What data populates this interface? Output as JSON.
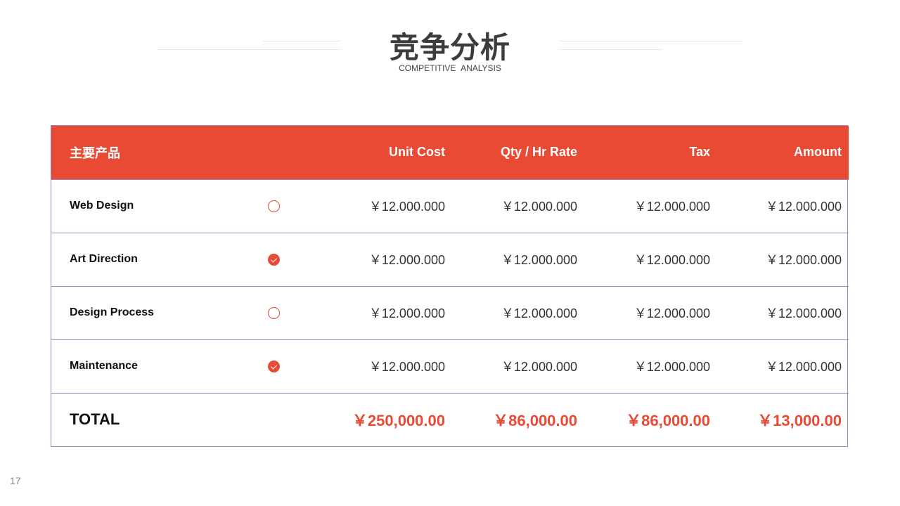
{
  "header": {
    "title": "竞争分析",
    "subtitle": "COMPETITIVE  ANALYSIS"
  },
  "table": {
    "columns": [
      "主要产品",
      "",
      "Unit Cost",
      "Qty / Hr Rate",
      "Tax",
      "Amount"
    ],
    "rows": [
      {
        "name": "Web Design",
        "checked": false,
        "unit_cost": "￥12.000.000",
        "qty_rate": "￥12.000.000",
        "tax": "￥12.000.000",
        "amount": "￥12.000.000"
      },
      {
        "name": "Art Direction",
        "checked": true,
        "unit_cost": "￥12.000.000",
        "qty_rate": "￥12.000.000",
        "tax": "￥12.000.000",
        "amount": "￥12.000.000"
      },
      {
        "name": "Design Process",
        "checked": false,
        "unit_cost": "￥12.000.000",
        "qty_rate": "￥12.000.000",
        "tax": "￥12.000.000",
        "amount": "￥12.000.000"
      },
      {
        "name": "Maintenance",
        "checked": true,
        "unit_cost": "￥12.000.000",
        "qty_rate": "￥12.000.000",
        "tax": "￥12.000.000",
        "amount": "￥12.000.000"
      }
    ],
    "total": {
      "label": "TOTAL",
      "unit_cost": "￥250,000.00",
      "qty_rate": "￥86,000.00",
      "tax": "￥86,000.00",
      "amount": "￥13,000.00"
    }
  },
  "footer": {
    "page_number": "17"
  },
  "colors": {
    "accent": "#e84a33",
    "border": "#8e8cb8",
    "title": "#3c3c3c"
  },
  "icons": {
    "unchecked": "circle-outline-icon",
    "checked": "check-circle-icon"
  }
}
